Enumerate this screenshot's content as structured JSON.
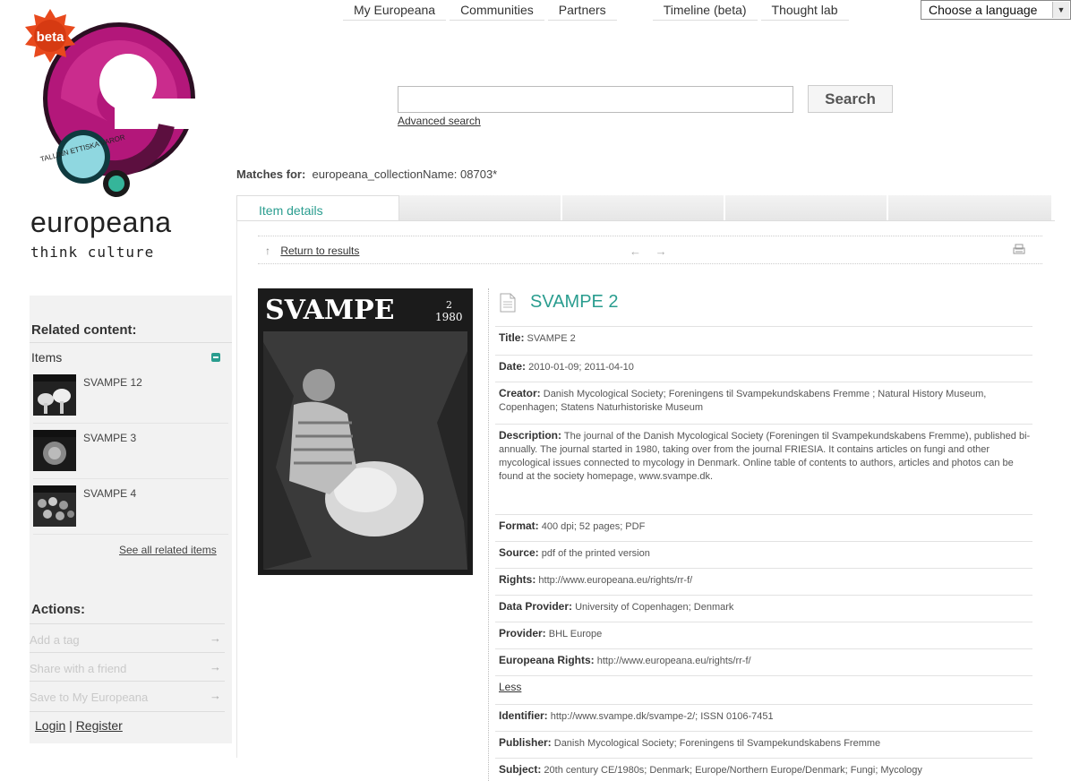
{
  "nav": {
    "items": [
      "My Europeana",
      "Communities",
      "Partners",
      "Timeline (beta)",
      "Thought lab"
    ],
    "language_select": "Choose a language"
  },
  "logo": {
    "badge": "beta",
    "wordmark": "europeana",
    "tagline": "think culture",
    "bubble_text": "TALLINN ETTISKA VAROR"
  },
  "search": {
    "value": "",
    "button": "Search",
    "advanced": "Advanced search"
  },
  "matches": {
    "label": "Matches for:",
    "query": "europeana_collectionName: 08703*"
  },
  "tabs": {
    "active": "Item details"
  },
  "results_bar": {
    "return_link": "Return to results",
    "up_arrow": "↑",
    "prev": "←",
    "next": "→"
  },
  "thumbnail": {
    "masthead": "SVAMPE",
    "issue": "2",
    "year": "1980"
  },
  "item": {
    "title": "SVAMPE 2",
    "fields": [
      {
        "label": "Title:",
        "value": "SVAMPE 2"
      },
      {
        "label": "Date:",
        "value": "2010-01-09;  2011-04-10"
      },
      {
        "label": "Creator:",
        "value": "Danish Mycological Society;  Foreningens til Svampekundskabens Fremme ;  Natural History Museum, Copenhagen;  Statens Naturhistoriske Museum"
      },
      {
        "label": "Description:",
        "value": "The journal of the Danish Mycological Society (Foreningen til Svampekundskabens Fremme), published bi-annually. The journal started in 1980, taking over from the journal FRIESIA. It contains articles on fungi and other mycological issues connected to mycology in Denmark. Online table of contents to authors, articles and photos can be found at the society homepage, www.svampe.dk."
      },
      {
        "label": "Format:",
        "value": "400 dpi;  52 pages;  PDF"
      },
      {
        "label": "Source:",
        "value": "pdf of the printed version"
      },
      {
        "label": "Rights:",
        "value": "http://www.europeana.eu/rights/rr-f/"
      },
      {
        "label": "Data Provider:",
        "value": "University of Copenhagen; Denmark"
      },
      {
        "label": "Provider:",
        "value": "BHL Europe"
      },
      {
        "label": "Europeana Rights:",
        "value": "http://www.europeana.eu/rights/rr-f/"
      }
    ],
    "less": "Less",
    "extra_fields": [
      {
        "label": "Identifier:",
        "value": "http://www.svampe.dk/svampe-2/;  ISSN 0106-7451"
      },
      {
        "label": "Publisher:",
        "value": "Danish Mycological Society;  Foreningens til Svampekundskabens Fremme"
      },
      {
        "label": "Subject:",
        "value": "20th century CE/1980s;  Denmark;  Europe/Northern Europe/Denmark;  Fungi;  Mycology"
      }
    ]
  },
  "sidebar": {
    "related_heading": "Related content:",
    "items_label": "Items",
    "related_items": [
      {
        "title": "SVAMPE 12"
      },
      {
        "title": "SVAMPE 3"
      },
      {
        "title": "SVAMPE 4"
      }
    ],
    "see_all": "See all related items",
    "actions_heading": "Actions:",
    "actions": [
      "Add a tag",
      "Share with a friend",
      "Save to My Europeana"
    ],
    "login": "Login",
    "separator": "|",
    "register": "Register"
  },
  "colors": {
    "accent": "#2a9d8f",
    "logo_magenta": "#c0187e",
    "badge_orange": "#e8491d"
  },
  "icons": [
    "print-icon",
    "document-icon",
    "up-arrow-icon",
    "prev-arrow-icon",
    "next-arrow-icon",
    "minus-toggle-icon",
    "dropdown-arrow-icon",
    "right-arrow-icon"
  ]
}
